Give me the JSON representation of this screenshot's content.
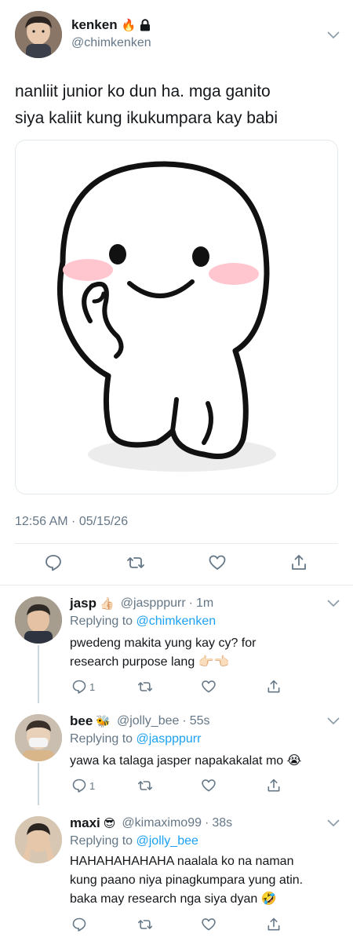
{
  "main_tweet": {
    "display_name": "kenken",
    "name_emoji": "🔥",
    "locked_icon": "lock-icon",
    "handle": "@chimkenken",
    "text": "nanliit junior ko dun ha. mga ganito\nsiya kaliit kung ikukumpara kay babi",
    "timestamp": "12:56 AM · 05/15/26",
    "actions": [
      "reply-icon",
      "retweet-icon",
      "like-icon",
      "share-icon"
    ]
  },
  "replies": [
    {
      "display_name": "jasp",
      "name_emoji": "👍🏻",
      "handle": "@jaspppurr",
      "time": "1m",
      "replying_prefix": "Replying to",
      "replying_to": "@chimkenken",
      "text": "pwedeng makita yung kay cy? for\nresearch purpose lang 👉🏻👈🏻",
      "reply_count": "1"
    },
    {
      "display_name": "bee",
      "name_emoji": "🐝",
      "handle": "@jolly_bee",
      "time": "55s",
      "replying_prefix": "Replying to",
      "replying_to": "@jaspppurr",
      "text": "yawa ka talaga jasper napakakalat mo 😭",
      "reply_count": "1"
    },
    {
      "display_name": "maxi",
      "name_emoji": "😎",
      "handle": "@kimaximo99",
      "time": "38s",
      "replying_prefix": "Replying to",
      "replying_to": "@jolly_bee",
      "text": "HAHAHAHAHAHA naalala ko na naman\nkung paano niya pinagkumpara yung atin.\nbaka may research nga siya dyan 🤣",
      "reply_count": ""
    }
  ],
  "colors": {
    "link": "#1da1f2",
    "secondary_text": "#657786",
    "divider": "#e6ecf0",
    "primary_text": "#14171a"
  }
}
